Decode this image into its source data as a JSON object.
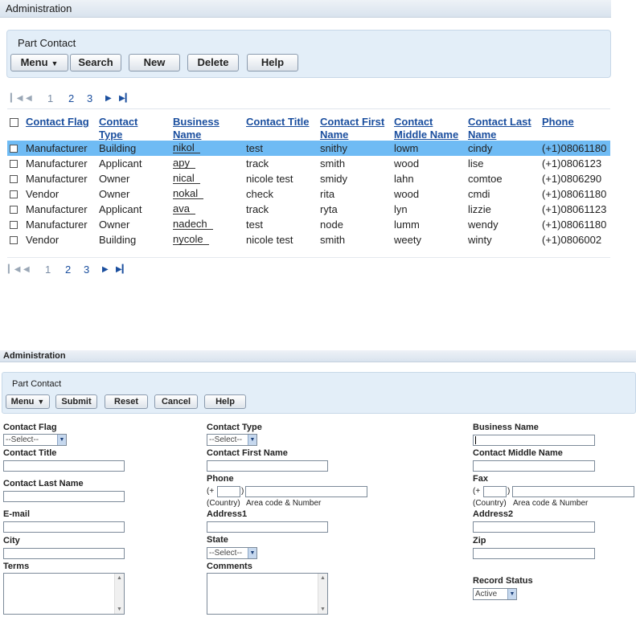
{
  "top": {
    "admin_title": "Administration",
    "panel_title": "Part Contact",
    "toolbar": {
      "menu": "Menu",
      "search": "Search",
      "new": "New",
      "delete": "Delete",
      "help": "Help"
    },
    "pager": {
      "pages": [
        "1",
        "2",
        "3"
      ]
    },
    "columns": [
      "Contact Flag",
      "Contact Type",
      "Business Name",
      "Contact Title",
      "Contact First Name",
      "Contact Middle Name",
      "Contact Last Name",
      "Phone"
    ],
    "rows": [
      {
        "flag": "Manufacturer",
        "type": "Building",
        "business": "nikol",
        "title": "test",
        "first": "snithy",
        "middle": "lowm",
        "last": "cindy",
        "phone": "(+1)08061180"
      },
      {
        "flag": "Manufacturer",
        "type": "Applicant",
        "business": "apy",
        "title": "track",
        "first": "smith",
        "middle": "wood",
        "last": "lise",
        "phone": "(+1)0806123"
      },
      {
        "flag": "Manufacturer",
        "type": "Owner",
        "business": "nical",
        "title": "nicole test",
        "first": "smidy",
        "middle": "lahn",
        "last": "comtoe",
        "phone": "(+1)0806290"
      },
      {
        "flag": "Vendor",
        "type": "Owner",
        "business": "nokal",
        "title": "check",
        "first": "rita",
        "middle": "wood",
        "last": "cmdi",
        "phone": "(+1)08061180"
      },
      {
        "flag": "Manufacturer",
        "type": "Applicant",
        "business": "ava",
        "title": "track",
        "first": "ryta",
        "middle": "lyn",
        "last": "lizzie",
        "phone": "(+1)08061123"
      },
      {
        "flag": "Manufacturer",
        "type": "Owner",
        "business": "nadech",
        "title": "test",
        "first": "node",
        "middle": "lumm",
        "last": "wendy",
        "phone": "(+1)08061180"
      },
      {
        "flag": "Vendor",
        "type": "Building",
        "business": "nycole",
        "title": "nicole test",
        "first": "smith",
        "middle": "weety",
        "last": "winty",
        "phone": "(+1)0806002"
      }
    ],
    "selected_row": 0
  },
  "bottom": {
    "admin_title": "Administration",
    "panel_title": "Part Contact",
    "toolbar": {
      "menu": "Menu",
      "submit": "Submit",
      "reset": "Reset",
      "cancel": "Cancel",
      "help": "Help"
    },
    "form": {
      "contact_flag_label": "Contact Flag",
      "contact_flag_value": "--Select--",
      "contact_type_label": "Contact Type",
      "contact_type_value": "--Select--",
      "business_name_label": "Business Name",
      "contact_title_label": "Contact Title",
      "contact_first_name_label": "Contact First Name",
      "contact_middle_name_label": "Contact Middle Name",
      "contact_last_name_label": "Contact Last Name",
      "phone_label": "Phone",
      "fax_label": "Fax",
      "plus_prefix": "(+",
      "paren_close": ")",
      "country_hint": "(Country)",
      "area_hint": "Area code & Number",
      "email_label": "E-mail",
      "address1_label": "Address1",
      "address2_label": "Address2",
      "city_label": "City",
      "state_label": "State",
      "state_value": "--Select--",
      "zip_label": "Zip",
      "terms_label": "Terms",
      "comments_label": "Comments",
      "record_status_label": "Record Status",
      "record_status_value": "Active"
    }
  }
}
